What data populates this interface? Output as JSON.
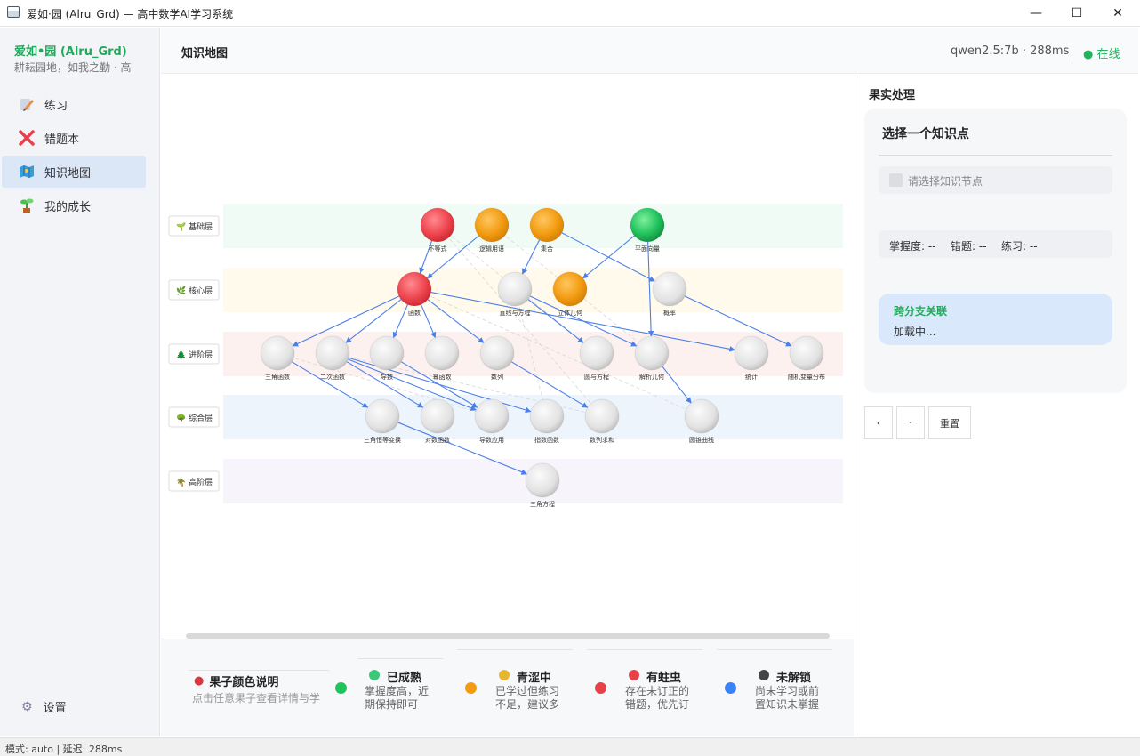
{
  "window": {
    "title": "爱如·园 (Alru_Grd) — 高中数学AI学习系统",
    "min": "—",
    "max": "☐",
    "close": "✕"
  },
  "sidebar": {
    "brand": "爱如•园 (Alru_Grd)",
    "motto": "耕耘园地，如我之勤 · 高",
    "items": [
      {
        "label": "练习",
        "icon": "pencil-icon"
      },
      {
        "label": "错题本",
        "icon": "cross-icon"
      },
      {
        "label": "知识地图",
        "icon": "map-icon"
      },
      {
        "label": "我的成长",
        "icon": "sprout-icon"
      }
    ],
    "settings": "设置"
  },
  "header": {
    "title": "知识地图",
    "model": "qwen2.5:7b · 288ms",
    "status": "● 在线"
  },
  "colors": {
    "ripe": "#22c35e",
    "green": "#f39c12",
    "bug": "#e8414a",
    "locked": "#3b82f6",
    "grey": "#dedede"
  },
  "map": {
    "layers": [
      {
        "label": "基础层",
        "icon": "🌱",
        "bg": "#f1fbf5"
      },
      {
        "label": "核心层",
        "icon": "🌿",
        "bg": "#fffaeb"
      },
      {
        "label": "进阶层",
        "icon": "🌲",
        "bg": "#fdf1ef"
      },
      {
        "label": "综合层",
        "icon": "🌳",
        "bg": "#eef4fc"
      },
      {
        "label": "高阶层",
        "icon": "🌴",
        "bg": "#f8f4fb"
      }
    ],
    "nodes": [
      {
        "label": "不等式",
        "layer": 0,
        "status": "bug"
      },
      {
        "label": "逻辑用语",
        "layer": 0,
        "status": "green"
      },
      {
        "label": "集合",
        "layer": 0,
        "status": "green"
      },
      {
        "label": "平面向量",
        "layer": 0,
        "status": "ripe"
      },
      {
        "label": "函数",
        "layer": 1,
        "status": "bug"
      },
      {
        "label": "直线与方程",
        "layer": 1,
        "status": "grey"
      },
      {
        "label": "立体几何",
        "layer": 1,
        "status": "green"
      },
      {
        "label": "概率",
        "layer": 1,
        "status": "grey"
      },
      {
        "label": "三角函数",
        "layer": 2,
        "status": "grey"
      },
      {
        "label": "二次函数",
        "layer": 2,
        "status": "grey"
      },
      {
        "label": "导数",
        "layer": 2,
        "status": "grey"
      },
      {
        "label": "幂函数",
        "layer": 2,
        "status": "grey"
      },
      {
        "label": "数列",
        "layer": 2,
        "status": "grey"
      },
      {
        "label": "圆与方程",
        "layer": 2,
        "status": "grey"
      },
      {
        "label": "解析几何",
        "layer": 2,
        "status": "grey"
      },
      {
        "label": "统计",
        "layer": 2,
        "status": "grey"
      },
      {
        "label": "随机变量分布",
        "layer": 2,
        "status": "grey"
      },
      {
        "label": "三角恒等变换",
        "layer": 3,
        "status": "grey"
      },
      {
        "label": "对数函数",
        "layer": 3,
        "status": "grey"
      },
      {
        "label": "导数应用",
        "layer": 3,
        "status": "grey"
      },
      {
        "label": "指数函数",
        "layer": 3,
        "status": "grey"
      },
      {
        "label": "数列求和",
        "layer": 3,
        "status": "grey"
      },
      {
        "label": "圆锥曲线",
        "layer": 3,
        "status": "grey"
      },
      {
        "label": "三角方程",
        "layer": 4,
        "status": "grey"
      }
    ],
    "edges": [
      [
        0,
        4
      ],
      [
        1,
        4
      ],
      [
        2,
        5
      ],
      [
        2,
        7
      ],
      [
        3,
        6
      ],
      [
        3,
        14
      ],
      [
        4,
        8
      ],
      [
        4,
        9
      ],
      [
        4,
        10
      ],
      [
        4,
        11
      ],
      [
        4,
        12
      ],
      [
        4,
        15
      ],
      [
        5,
        13
      ],
      [
        5,
        14
      ],
      [
        7,
        16
      ],
      [
        9,
        18
      ],
      [
        9,
        19
      ],
      [
        9,
        20
      ],
      [
        8,
        17
      ],
      [
        10,
        19
      ],
      [
        12,
        21
      ],
      [
        14,
        22
      ],
      [
        17,
        23
      ]
    ],
    "dashed": [
      [
        0,
        13
      ],
      [
        1,
        14
      ],
      [
        4,
        22
      ],
      [
        8,
        19
      ],
      [
        9,
        21
      ],
      [
        5,
        20
      ],
      [
        0,
        21
      ]
    ]
  },
  "legend": {
    "title": "果子颜色说明",
    "hint": "点击任意果子查看详情与学",
    "items": [
      {
        "name": "已成熟",
        "desc": "掌握度高，近期保持即可",
        "color": "#22c35e",
        "icon_color": "#3cc879"
      },
      {
        "name": "青涩中",
        "desc": "已学过但练习不足，建议多做习题",
        "color": "#f39c12",
        "icon_color": "#e8b62c"
      },
      {
        "name": "有蛀虫",
        "desc": "存在未订正的错题，优先订正，复习",
        "color": "#e8414a",
        "icon_color": "#e8414a"
      },
      {
        "name": "未解锁",
        "desc": "尚未学习或前置知识未掌握",
        "color": "#3b82f6",
        "icon_color": "#444"
      }
    ]
  },
  "panel": {
    "title": "果实处理",
    "card_title": "选择一个知识点",
    "select_placeholder": "请选择知识节点",
    "mastery": "掌握度: --",
    "wrong": "错题: --",
    "practice": "练习: --",
    "cross_title": "跨分支关联",
    "cross_text": "加载中...",
    "btn_a": "‹",
    "btn_b": "·",
    "btn_reset": "重置"
  },
  "status": "模式: auto | 延迟: 288ms"
}
